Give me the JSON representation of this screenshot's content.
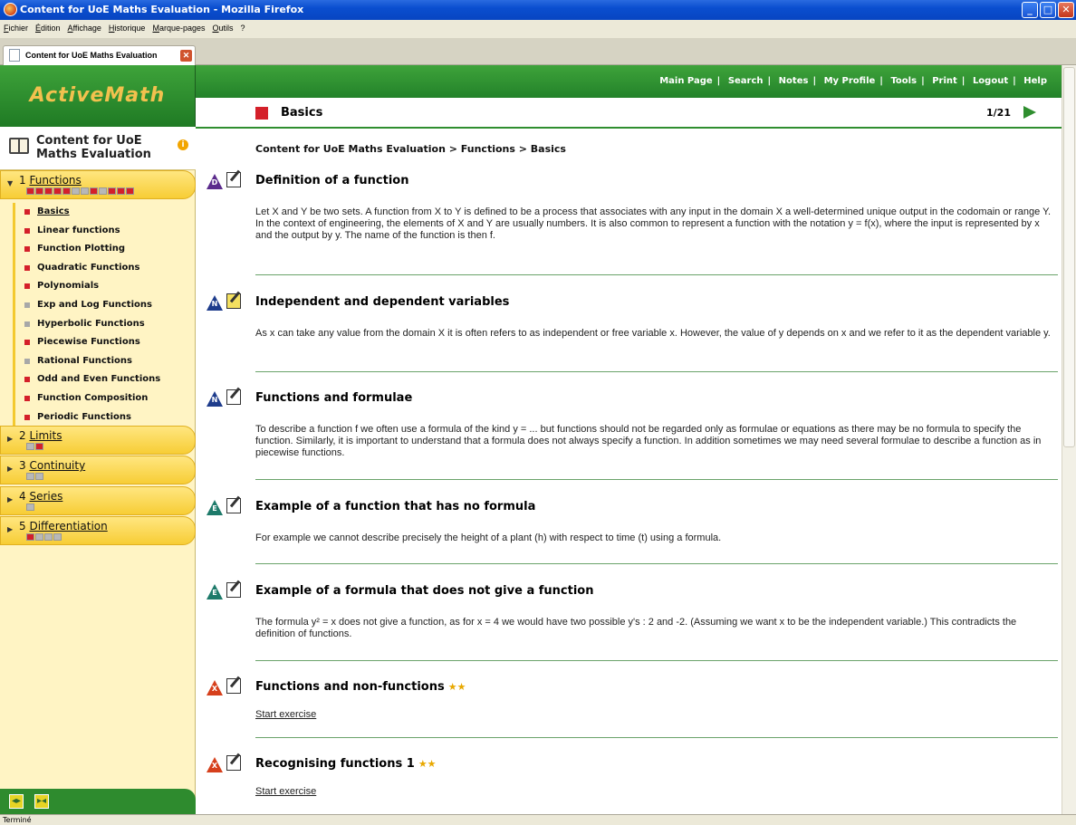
{
  "window": {
    "title": "Content for UoE Maths Evaluation - Mozilla Firefox"
  },
  "menu": [
    "Fichier",
    "Édition",
    "Affichage",
    "Historique",
    "Marque-pages",
    "Outils",
    "?"
  ],
  "tab": {
    "label": "Content for UoE Maths Evaluation"
  },
  "logo": "ActiveMath",
  "course": {
    "title": "Content for UoE Maths Evaluation"
  },
  "chapters": [
    {
      "number": "1",
      "label": "Functions",
      "expanded": true
    },
    {
      "number": "2",
      "label": "Limits",
      "expanded": false
    },
    {
      "number": "3",
      "label": "Continuity",
      "expanded": false
    },
    {
      "number": "4",
      "label": "Series",
      "expanded": false
    },
    {
      "number": "5",
      "label": "Differentiation",
      "expanded": false
    }
  ],
  "lessons": [
    {
      "label": "Basics",
      "current": true,
      "color": "red"
    },
    {
      "label": "Linear functions",
      "color": "red"
    },
    {
      "label": "Function Plotting",
      "color": "red"
    },
    {
      "label": "Quadratic Functions",
      "color": "red"
    },
    {
      "label": "Polynomials",
      "color": "red"
    },
    {
      "label": "Exp and Log Functions",
      "color": "grey"
    },
    {
      "label": "Hyperbolic Functions",
      "color": "grey"
    },
    {
      "label": "Piecewise Functions",
      "color": "red"
    },
    {
      "label": "Rational Functions",
      "color": "grey"
    },
    {
      "label": "Odd and Even Functions",
      "color": "red"
    },
    {
      "label": "Function Composition",
      "color": "red"
    },
    {
      "label": "Periodic Functions",
      "color": "red"
    }
  ],
  "topnav": [
    "Main Page",
    "Search",
    "Notes",
    "My Profile",
    "Tools",
    "Print",
    "Logout",
    "Help"
  ],
  "page": {
    "title": "Basics",
    "counter": "1/21"
  },
  "breadcrumb": "Content for UoE Maths Evaluation > Functions > Basics",
  "items": [
    {
      "badge": "D",
      "badge_color": "#5b2b8c",
      "title": "Definition of a function",
      "text": "Let X and Y be two sets. A function from X to Y is defined to be a process that associates with any input in the domain X a well-determined unique output in the codomain or range Y. In the context of engineering, the elements of X and Y are usually numbers. It is also common to represent a function with the notation y = f(x), where the input is represented by x and the output by y. The name of the function is then f."
    },
    {
      "badge": "N",
      "badge_color": "#1e3c8c",
      "title": "Independent and dependent variables",
      "text": "As x can take any value from the domain X it is often refers to as independent or free variable x. However, the value of y depends on x and we refer to it as the dependent variable y."
    },
    {
      "badge": "N",
      "badge_color": "#1e3c8c",
      "title": "Functions and formulae",
      "text": "To describe a function f we often use a formula of the kind y = ... but functions should not be regarded only as formulae or equations as there may be no formula to specify the function. Similarly, it is important to understand that a formula does not always specify a function. In addition sometimes we may need several formulae to describe a function as in piecewise functions."
    },
    {
      "badge": "E",
      "badge_color": "#1d7a6a",
      "title": "Example of a function that has no formula",
      "text": "For example we cannot describe precisely the height of a plant (h) with respect to time (t) using a formula."
    },
    {
      "badge": "E",
      "badge_color": "#1d7a6a",
      "title": "Example of a formula that does not give a function",
      "text": "The formula y² = x does not give a function, as for x = 4 we would have two possible y's : 2 and -2. (Assuming we want x to be the independent variable.) This contradicts the definition of functions."
    },
    {
      "badge": "X",
      "badge_color": "#d6401c",
      "title": "Functions and non-functions",
      "stars": "★★",
      "link": "Start exercise"
    },
    {
      "badge": "X",
      "badge_color": "#d6401c",
      "title": "Recognising functions 1",
      "stars": "★★",
      "link": "Start exercise"
    }
  ],
  "status": "Terminé"
}
